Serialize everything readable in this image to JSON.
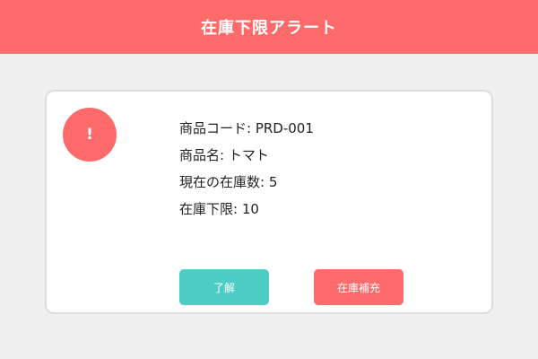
{
  "header": {
    "title": "在庫下限アラート"
  },
  "alert": {
    "icon": "exclamation-icon",
    "icon_glyph": "!",
    "lines": [
      "商品コード: PRD-001",
      "商品名: トマト",
      "現在の在庫数: 5",
      "在庫下限: 10"
    ]
  },
  "actions": {
    "acknowledge_label": "了解",
    "restock_label": "在庫補充"
  },
  "colors": {
    "accent": "#ff6b6b",
    "acknowledge": "#4ecdc4",
    "background": "#f0f0f0",
    "card": "#ffffff"
  }
}
